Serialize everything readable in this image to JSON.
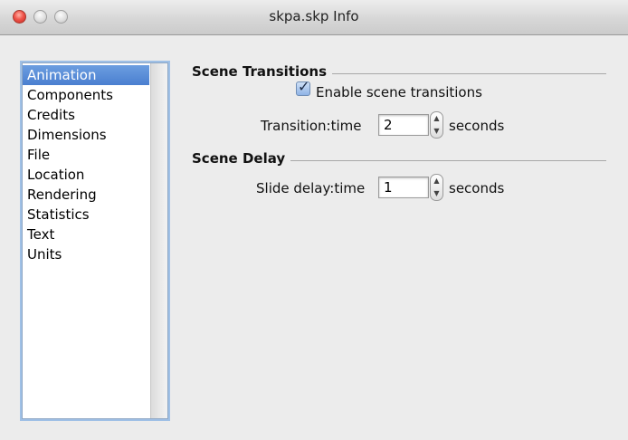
{
  "window": {
    "title": "skpa.skp Info"
  },
  "sidebar": {
    "items": [
      {
        "label": "Animation",
        "selected": true
      },
      {
        "label": "Components"
      },
      {
        "label": "Credits"
      },
      {
        "label": "Dimensions"
      },
      {
        "label": "File"
      },
      {
        "label": "Location"
      },
      {
        "label": "Rendering"
      },
      {
        "label": "Statistics"
      },
      {
        "label": "Text"
      },
      {
        "label": "Units"
      }
    ]
  },
  "scene_transitions": {
    "title": "Scene Transitions",
    "enable_label": "Enable scene transitions",
    "enable_checked": true,
    "transition_label": "Transition:time",
    "transition_value": "2",
    "transition_unit": "seconds"
  },
  "scene_delay": {
    "title": "Scene Delay",
    "delay_label": "Slide delay:time",
    "delay_value": "1",
    "delay_unit": "seconds"
  },
  "colors": {
    "selection": "#4a7fd0",
    "window_bg": "#ececec",
    "close_button": "#f0554b"
  },
  "icons": {
    "check": "checkmark-icon",
    "stepper_up": "triangle-up-icon",
    "stepper_down": "triangle-down-icon"
  }
}
